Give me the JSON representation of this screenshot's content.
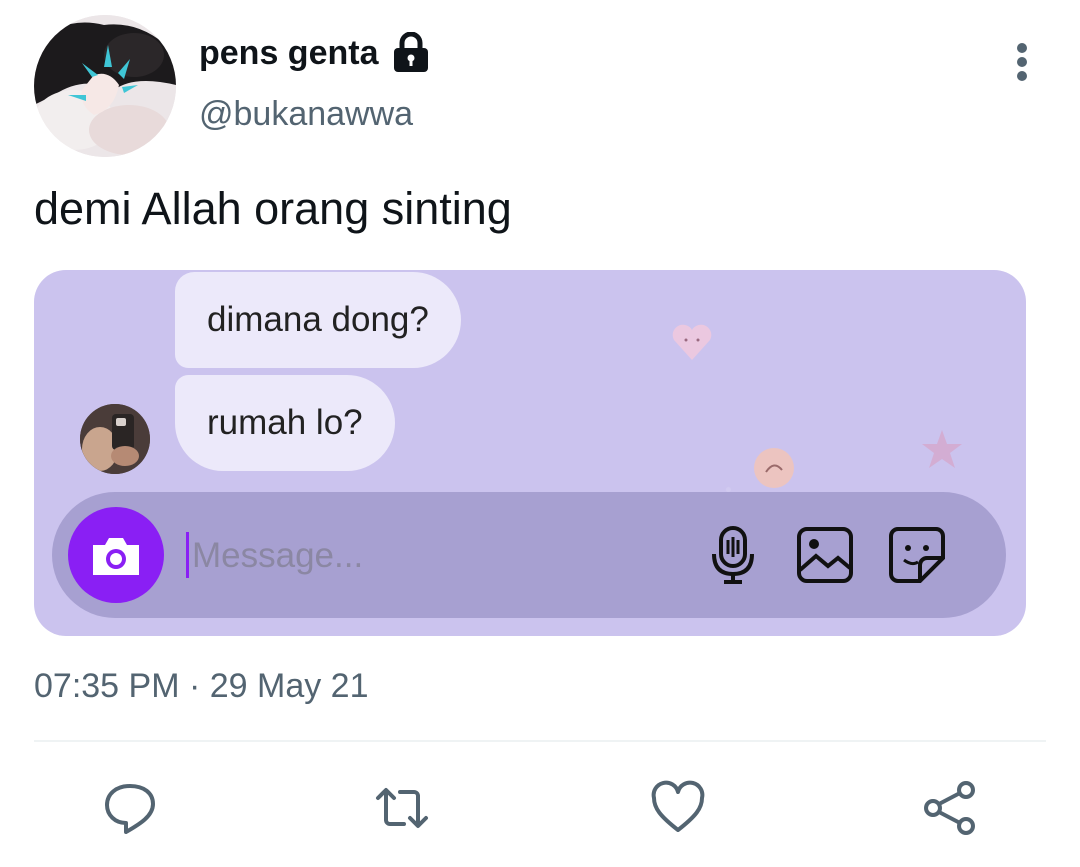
{
  "tweet": {
    "display_name": "pens genta",
    "handle": "@bukanawwa",
    "text": "demi Allah orang sinting",
    "timestamp": "07:35 PM · 29 May 21"
  },
  "icons": {
    "lock": "lock-icon",
    "more": "more-vertical-icon",
    "reply": "reply-icon",
    "retweet": "retweet-icon",
    "like": "heart-icon",
    "share": "share-icon"
  },
  "media": {
    "messages": [
      "dimana dong?",
      "rumah lo?"
    ],
    "composer": {
      "placeholder": "Message...",
      "icons": [
        "camera-icon",
        "microphone-icon",
        "gallery-icon",
        "sticker-icon"
      ]
    },
    "colors": {
      "background": "#cbc3ee",
      "composer": "#a7a0d1",
      "accent": "#8a1ff4",
      "bubble": "#ece9fa"
    }
  },
  "colors": {
    "text": "#0f1419",
    "secondary": "#536471"
  }
}
